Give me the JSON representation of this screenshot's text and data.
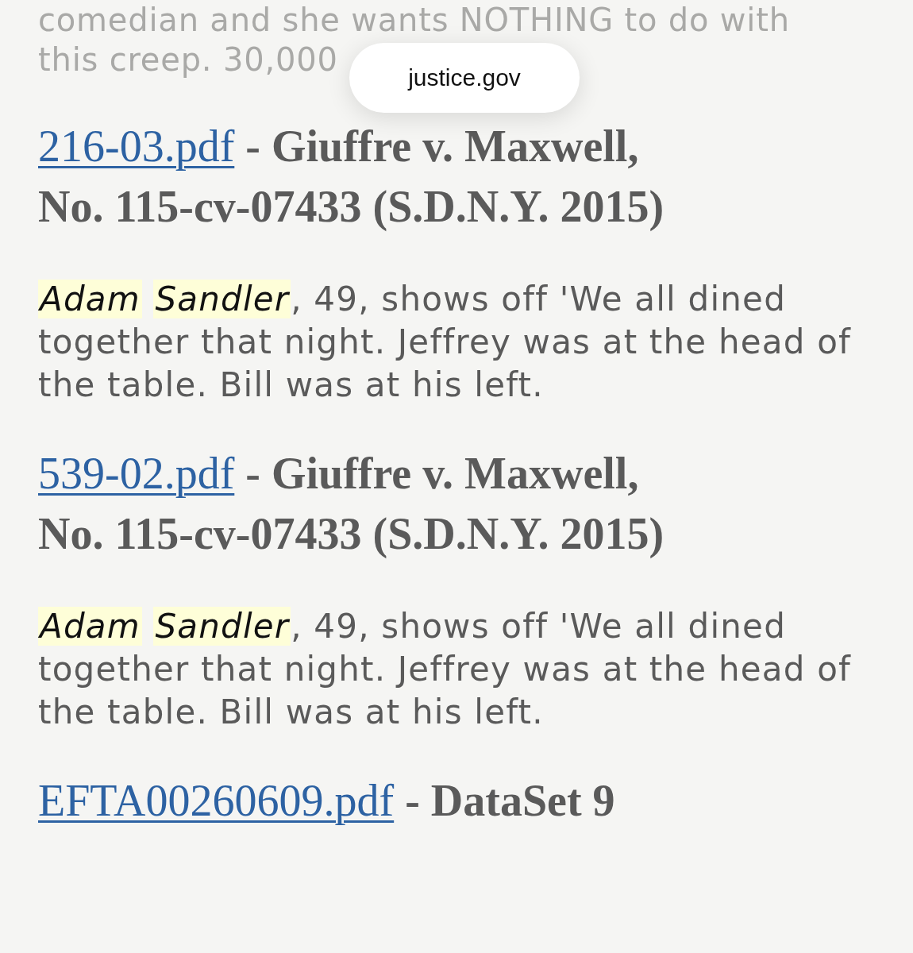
{
  "address_pill": {
    "domain": "justice.gov"
  },
  "previous_snippet_lines": [
    "comedian and she wants NOTHING to do with",
    "this creep. 30,000"
  ],
  "results": [
    {
      "link": "216-03.pdf",
      "separator": "-",
      "source": "Giuffre v. Maxwell, No. 115-cv-07433 (S.D.N.Y. 2015)",
      "snippet": {
        "highlighted_terms": [
          "Adam",
          "Sandler"
        ],
        "rest": ", 49, shows off 'We all dined together that night. Jeffrey was at the head of the table. Bill was at his left."
      }
    },
    {
      "link": "539-02.pdf",
      "separator": "-",
      "source": "Giuffre v. Maxwell, No. 115-cv-07433 (S.D.N.Y. 2015)",
      "snippet": {
        "highlighted_terms": [
          "Adam",
          "Sandler"
        ],
        "rest": ", 49, shows off 'We all dined together that night. Jeffrey was at the head of the table. Bill was at his left."
      }
    },
    {
      "link": "EFTA00260609.pdf",
      "separator": "-",
      "source": "DataSet 9"
    }
  ]
}
